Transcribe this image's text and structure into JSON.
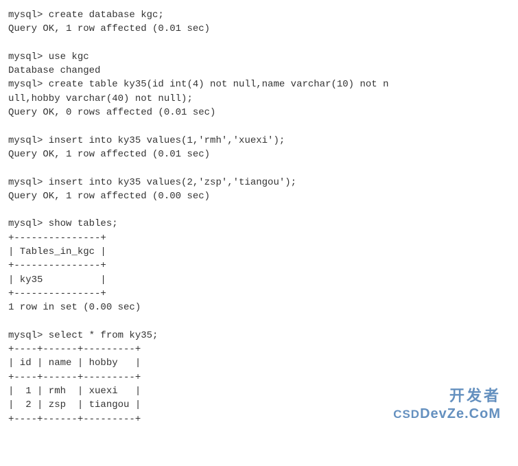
{
  "terminal": {
    "prompt": "mysql>",
    "lines": [
      "mysql> create database kgc;",
      "Query OK, 1 row affected (0.01 sec)",
      "",
      "mysql> use kgc",
      "Database changed",
      "mysql> create table ky35(id int(4) not null,name varchar(10) not n",
      "ull,hobby varchar(40) not null);",
      "Query OK, 0 rows affected (0.01 sec)",
      "",
      "mysql> insert into ky35 values(1,'rmh','xuexi');",
      "Query OK, 1 row affected (0.01 sec)",
      "",
      "mysql> insert into ky35 values(2,'zsp','tiangou');",
      "Query OK, 1 row affected (0.00 sec)",
      "",
      "mysql> show tables;",
      "+---------------+",
      "| Tables_in_kgc |",
      "+---------------+",
      "| ky35          |",
      "+---------------+",
      "1 row in set (0.00 sec)",
      "",
      "mysql> select * from ky35;",
      "+----+------+---------+",
      "| id | name | hobby   |",
      "+----+------+---------+",
      "|  1 | rmh  | xuexi   |",
      "|  2 | zsp  | tiangou |",
      "+----+------+---------+"
    ]
  },
  "watermark": {
    "line1": "开发者",
    "line2_left": "CSD",
    "line2_main": "DevZe.CoM",
    "overlay": ""
  },
  "chart_data": {
    "type": "table",
    "title": "ky35",
    "columns": [
      "id",
      "name",
      "hobby"
    ],
    "rows": [
      [
        1,
        "rmh",
        "xuexi"
      ],
      [
        2,
        "zsp",
        "tiangou"
      ]
    ]
  }
}
